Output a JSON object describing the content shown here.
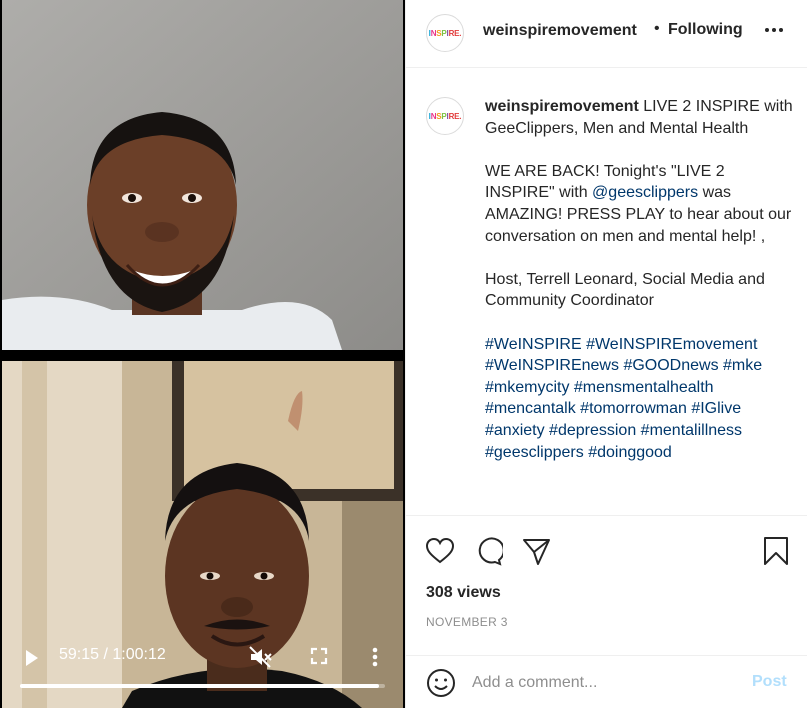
{
  "video": {
    "time_display": "59:15 / 1:00:12",
    "progress_fraction": 0.984
  },
  "header": {
    "avatar_text": "INSPIRE.",
    "username": "weinspiremovement",
    "separator": "•",
    "follow_state": "Following"
  },
  "caption": {
    "avatar_text": "INSPIRE.",
    "username": "weinspiremovement",
    "title": " LIVE 2 INSPIRE with GeeClippers, Men and Mental Health",
    "para1_a": "WE ARE BACK! Tonight's \"LIVE 2 INSPIRE\" with ",
    "para1_mention": "@geesclippers",
    "para1_b": " was AMAZING! PRESS PLAY to hear about our conversation on men and mental help! ,",
    "para2": "Host, Terrell Leonard, Social Media and Community Coordinator",
    "hashtags": [
      "#WeINSPIRE",
      "#WeINSPIREmovement",
      "#WeINSPIREnews",
      "#GOODnews",
      "#mke",
      "#mkemycity",
      "#mensmentalhealth",
      "#mencantalk",
      "#tomorrowman",
      "#IGlive",
      "#anxiety",
      "#depression",
      "#mentalillness",
      "#geesclippers",
      "#doinggood"
    ]
  },
  "stats": {
    "views": "308 views",
    "date": "NOVEMBER 3"
  },
  "comment": {
    "placeholder": "Add a comment...",
    "post_label": "Post"
  },
  "icons": {
    "play": "play-icon",
    "mute": "mute-icon",
    "fullscreen": "fullscreen-icon",
    "menu": "vertical-dots-icon",
    "more": "horizontal-dots-icon",
    "like": "heart-icon",
    "comment": "comment-icon",
    "share": "paper-plane-icon",
    "save": "bookmark-icon",
    "emoji": "emoji-icon"
  },
  "colors": {
    "link": "#00376b",
    "post_disabled": "#b2dffc",
    "muted_text": "#8e8e8e"
  }
}
